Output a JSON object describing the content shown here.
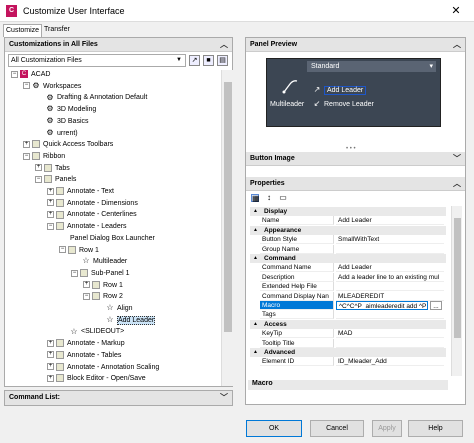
{
  "window": {
    "title": "Customize User Interface",
    "close_glyph": "✕",
    "app_icon_letter": "C",
    "app_icon_color": "#c4145e"
  },
  "tabs": [
    "Customize",
    "Transfer"
  ],
  "left": {
    "header": "Customizations in All Files",
    "filter": "All Customization Files",
    "tree": [
      {
        "label": "ACAD",
        "indent": 0,
        "exp": "−",
        "icon": "C"
      },
      {
        "label": "Workspaces",
        "indent": 1,
        "exp": "−",
        "icon": "⚙"
      },
      {
        "label": "Drafting & Annotation Default",
        "indent": 2,
        "exp": "",
        "icon": "⚙"
      },
      {
        "label": "3D Modeling",
        "indent": 2,
        "exp": "",
        "icon": "⚙"
      },
      {
        "label": "3D Basics",
        "indent": 2,
        "exp": "",
        "icon": "⚙"
      },
      {
        "label": "urrent)",
        "indent": 2,
        "exp": "",
        "icon": "⚙"
      },
      {
        "label": "Quick Access Toolbars",
        "indent": 1,
        "exp": "+",
        "icon": "▭"
      },
      {
        "label": "Ribbon",
        "indent": 1,
        "exp": "−",
        "icon": "▭"
      },
      {
        "label": "Tabs",
        "indent": 2,
        "exp": "+",
        "icon": "▭"
      },
      {
        "label": "Panels",
        "indent": 2,
        "exp": "−",
        "icon": "▭"
      },
      {
        "label": "Annotate - Text",
        "indent": 3,
        "exp": "+",
        "icon": "▭"
      },
      {
        "label": "Annotate - Dimensions",
        "indent": 3,
        "exp": "+",
        "icon": "▭"
      },
      {
        "label": "Annotate - Centerlines",
        "indent": 3,
        "exp": "+",
        "icon": "▭"
      },
      {
        "label": "Annotate - Leaders",
        "indent": 3,
        "exp": "−",
        "icon": "▭"
      },
      {
        "label": "Panel Dialog Box Launcher",
        "indent": 4,
        "exp": "",
        "icon": ""
      },
      {
        "label": "Row 1",
        "indent": 4,
        "exp": "−",
        "icon": "▭"
      },
      {
        "label": "Multileader",
        "indent": 5,
        "exp": "",
        "icon": "☆"
      },
      {
        "label": "Sub-Panel 1",
        "indent": 5,
        "exp": "−",
        "icon": "▭"
      },
      {
        "label": "Row 1",
        "indent": 6,
        "exp": "+",
        "icon": "▭"
      },
      {
        "label": "Row 2",
        "indent": 6,
        "exp": "−",
        "icon": "▭"
      },
      {
        "label": "Align",
        "indent": 7,
        "exp": "",
        "icon": "☆"
      },
      {
        "label": "Add Leader",
        "indent": 7,
        "exp": "",
        "icon": "☆"
      },
      {
        "label": "<SLIDEOUT>",
        "indent": 4,
        "exp": "",
        "icon": "☆"
      },
      {
        "label": "Annotate - Markup",
        "indent": 3,
        "exp": "+",
        "icon": "▭"
      },
      {
        "label": "Annotate - Tables",
        "indent": 3,
        "exp": "+",
        "icon": "▭"
      },
      {
        "label": "Annotate - Annotation Scaling",
        "indent": 3,
        "exp": "+",
        "icon": "▭"
      },
      {
        "label": "Block Editor - Open/Save",
        "indent": 3,
        "exp": "+",
        "icon": "▭"
      }
    ]
  },
  "command_list_header": "Command List:",
  "right": {
    "panel_preview_header": "Panel Preview",
    "preview": {
      "dropdown": "Standard",
      "big_label": "Multileader",
      "item1": "Add Leader",
      "item2": "Remove Leader"
    },
    "button_image_header": "Button Image",
    "properties_header": "Properties",
    "properties": [
      {
        "cat": "Display"
      },
      {
        "k": "Name",
        "v": "Add Leader"
      },
      {
        "cat": "Appearance"
      },
      {
        "k": "Button Style",
        "v": "SmallWithText"
      },
      {
        "k": "Group Name",
        "v": ""
      },
      {
        "cat": "Command"
      },
      {
        "k": "Command Name",
        "v": "Add Leader"
      },
      {
        "k": "Description",
        "v": "Add a leader line to an existing mul"
      },
      {
        "k": "Extended Help File",
        "v": ""
      },
      {
        "k": "Command Display Nan",
        "v": "MLEADEREDIT"
      },
      {
        "k": "Macro",
        "v": "^C^C^P_aimleaderedit add ^P",
        "hl": true
      },
      {
        "k": "Tags",
        "v": ""
      },
      {
        "cat": "Access"
      },
      {
        "k": "KeyTip",
        "v": "MAD"
      },
      {
        "k": "Tooltip Title",
        "v": ""
      },
      {
        "cat": "Advanced"
      },
      {
        "k": "Element ID",
        "v": "ID_Mleader_Add"
      }
    ],
    "macro_footer": "Macro"
  },
  "buttons": {
    "ok": "OK",
    "cancel": "Cancel",
    "apply": "Apply",
    "help": "Help"
  }
}
